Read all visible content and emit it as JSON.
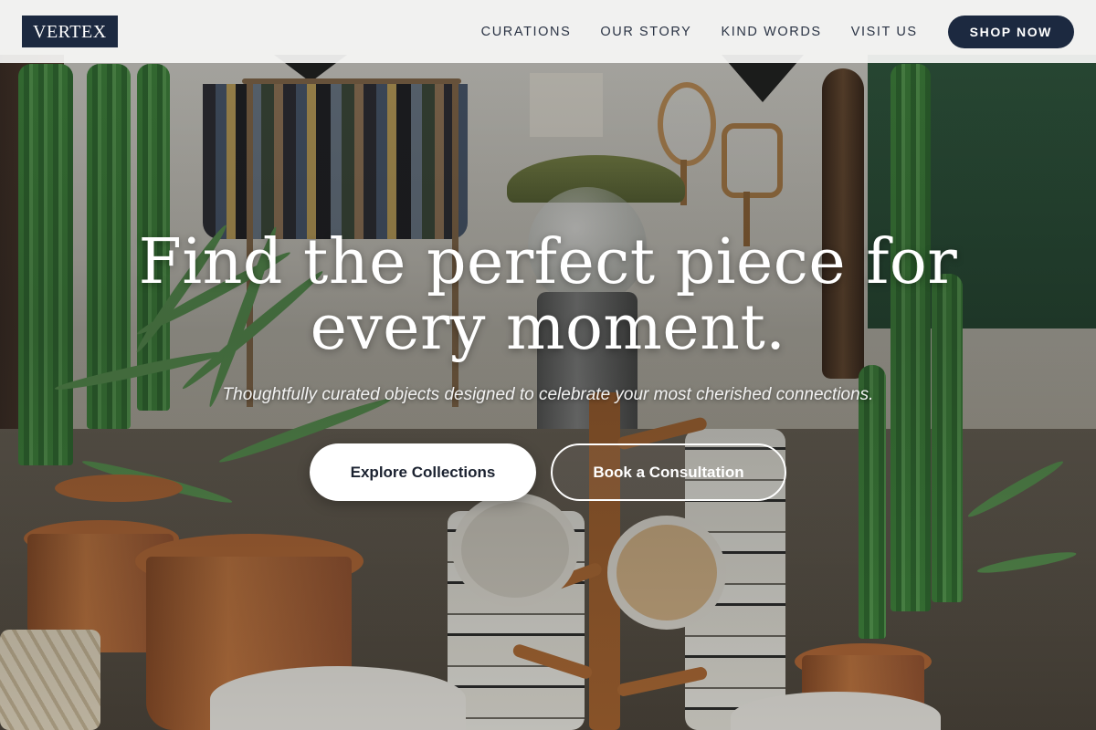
{
  "brand": {
    "logo_text": "VERTEX"
  },
  "nav": {
    "items": [
      {
        "label": "CURATIONS"
      },
      {
        "label": "OUR STORY"
      },
      {
        "label": "KIND WORDS"
      },
      {
        "label": "VISIT US"
      }
    ],
    "cta_label": "SHOP NOW"
  },
  "hero": {
    "title_line1": "Find the perfect piece for",
    "title_line2": "every moment.",
    "subtitle": "Thoughtfully curated objects designed to celebrate your most cherished connections.",
    "primary_button": "Explore Collections",
    "secondary_button": "Book a Consultation",
    "background_image": "shop-interior-photo"
  },
  "colors": {
    "brand_navy": "#1c2940",
    "header_bg": "#f7f7f6",
    "text_white": "#ffffff"
  }
}
